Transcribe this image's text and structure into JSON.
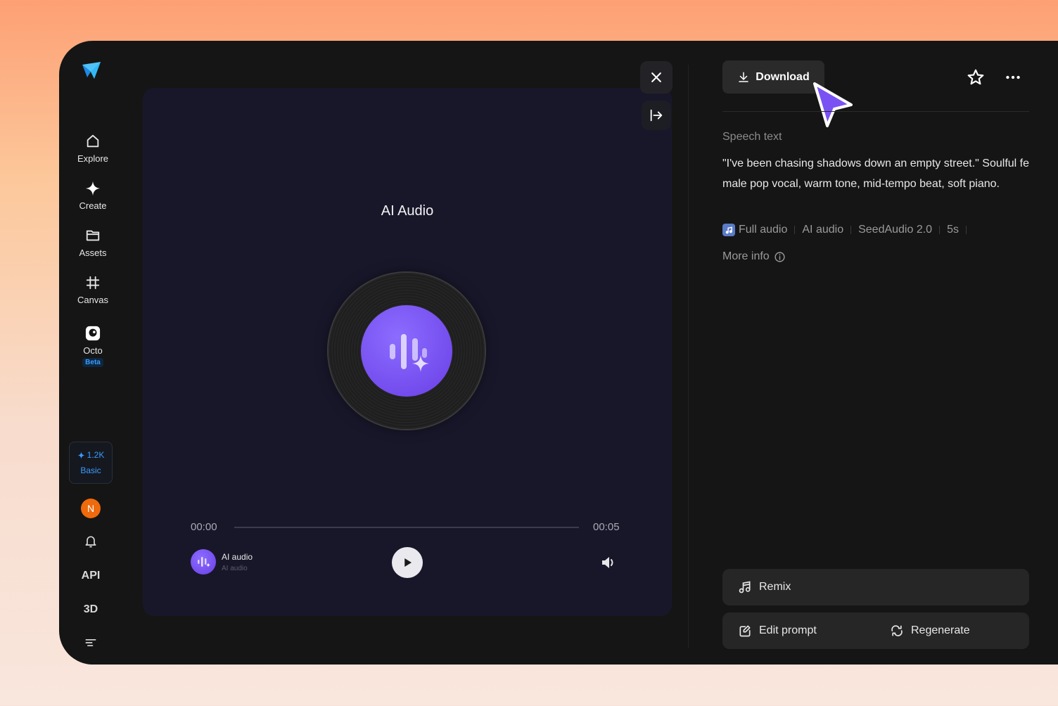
{
  "colors": {
    "accent": "#3b9bff",
    "purple": "#7a52f4",
    "avatar": "#ee6a0c"
  },
  "sidebar": {
    "logo_icon": "app-logo-icon",
    "items": [
      {
        "label": "Explore",
        "icon": "home-icon"
      },
      {
        "label": "Create",
        "icon": "sparkle-icon"
      },
      {
        "label": "Assets",
        "icon": "folder-icon"
      },
      {
        "label": "Canvas",
        "icon": "canvas-grid-icon"
      },
      {
        "label": "Octo",
        "icon": "octo-icon",
        "badge": "Beta"
      }
    ],
    "credits": {
      "amount": "1.2K",
      "plan": "Basic"
    },
    "avatar_initial": "N",
    "api_label": "API",
    "three_d_label": "3D"
  },
  "player": {
    "title": "AI Audio",
    "time_current": "00:00",
    "time_total": "00:05",
    "progress": 0,
    "track_name": "AI audio",
    "track_sub": "AI audio"
  },
  "details": {
    "download_label": "Download",
    "speech_label": "Speech text",
    "speech_text": "\"I've been chasing shadows down an empty street.\" Soulful female pop vocal, warm tone, mid-tempo beat, soft piano.",
    "meta": [
      "Full audio",
      "AI audio",
      "SeedAudio 2.0",
      "5s"
    ],
    "more_info": "More info",
    "remix_label": "Remix",
    "edit_prompt_label": "Edit prompt",
    "regenerate_label": "Regenerate"
  }
}
